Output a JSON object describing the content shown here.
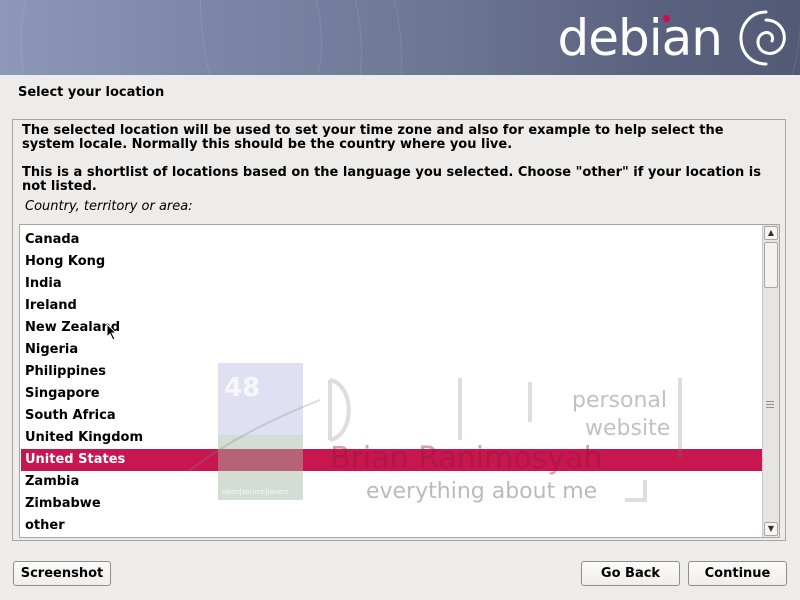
{
  "header": {
    "brand": "debian",
    "logo_icon": "debian-swirl-icon",
    "accent_color": "#d70751"
  },
  "page": {
    "title": "Select your location",
    "description_1": "The selected location will be used to set your time zone and also for example to help select the system locale. Normally this should be the country where you live.",
    "description_2": "This is a shortlist of locations based on the language you selected. Choose \"other\" if your location is not listed.",
    "list_label": "Country, territory or area:"
  },
  "countries": {
    "items": [
      "Canada",
      "Hong Kong",
      "India",
      "Ireland",
      "New Zealand",
      "Nigeria",
      "Philippines",
      "Singapore",
      "South Africa",
      "United Kingdom",
      "United States",
      "Zambia",
      "Zimbabwe",
      "other"
    ],
    "selected": "United States",
    "selected_color": "#c8164f"
  },
  "watermark": {
    "number": "48",
    "tag": "open|source|lovers",
    "line1": "personal",
    "line2": "website",
    "name": "Brian Ranimosyah",
    "tagline": "everything about me"
  },
  "buttons": {
    "screenshot": "Screenshot",
    "go_back": "Go Back",
    "continue": "Continue"
  }
}
